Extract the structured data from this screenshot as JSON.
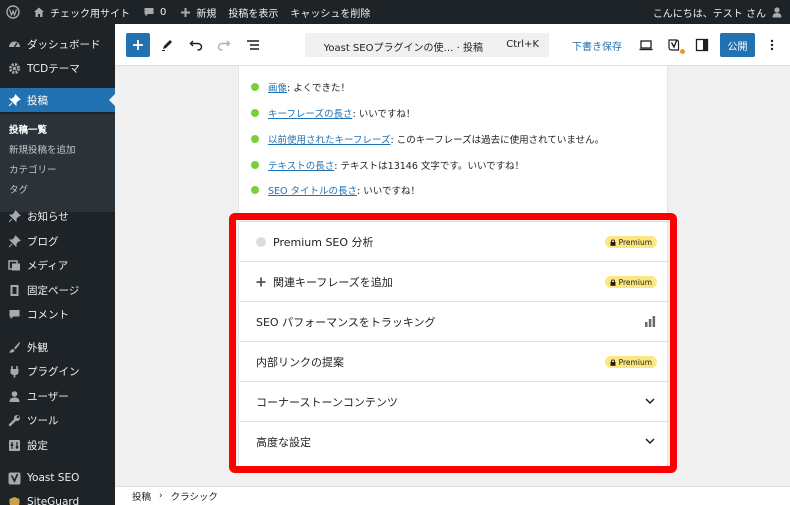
{
  "admin_bar": {
    "site_name": "チェック用サイト",
    "comments_count": "0",
    "new_label": "新規",
    "view_post": "投稿を表示",
    "purge_cache": "キャッシュを削除",
    "greeting": "こんにちは、テスト さん"
  },
  "sidebar": {
    "items": [
      {
        "label": "ダッシュボード",
        "icon": "dashboard-icon"
      },
      {
        "label": "TCDテーマ",
        "icon": "gear-icon"
      },
      {
        "label": "投稿",
        "icon": "pin-icon",
        "active": true
      },
      {
        "label": "お知らせ",
        "icon": "pin-icon"
      },
      {
        "label": "ブログ",
        "icon": "pin-icon"
      },
      {
        "label": "メディア",
        "icon": "media-icon"
      },
      {
        "label": "固定ページ",
        "icon": "page-icon"
      },
      {
        "label": "コメント",
        "icon": "comment-icon"
      },
      {
        "label": "外観",
        "icon": "brush-icon"
      },
      {
        "label": "プラグイン",
        "icon": "plugin-icon"
      },
      {
        "label": "ユーザー",
        "icon": "user-icon"
      },
      {
        "label": "ツール",
        "icon": "wrench-icon"
      },
      {
        "label": "設定",
        "icon": "settings-icon"
      },
      {
        "label": "Yoast SEO",
        "icon": "yoast-icon"
      },
      {
        "label": "SiteGuard",
        "icon": "shield-icon"
      }
    ],
    "submenu": [
      "投稿一覧",
      "新規投稿を追加",
      "カテゴリー",
      "タグ"
    ]
  },
  "toolbar": {
    "doc_title": "Yoast SEOプラグインの使…  · 投稿",
    "shortcut": "Ctrl+K",
    "save_draft": "下書き保存",
    "publish": "公開"
  },
  "checks": [
    {
      "link": "画像",
      "text": ": よくできた！"
    },
    {
      "link": "キーフレーズの長さ",
      "text": ": いいですね！"
    },
    {
      "link": "以前使用されたキーフレーズ",
      "text": ": このキーフレーズは過去に使用されていません。"
    },
    {
      "link": "テキストの長さ",
      "text": ": テキストは13146 文字です。いいですね！"
    },
    {
      "link": "SEO タイトルの長さ",
      "text": ": いいですね！"
    }
  ],
  "features": {
    "premium_analysis": "Premium SEO 分析",
    "related_keyphrase": "関連キーフレーズを追加",
    "tracking": "SEO パフォーマンスをトラッキング",
    "internal_links": "内部リンクの提案",
    "cornerstone": "コーナーストーンコンテンツ",
    "advanced": "高度な設定",
    "premium_badge": "Premium"
  },
  "breadcrumb": {
    "first": "投稿",
    "separator": "›",
    "second": "クラシック"
  },
  "colors": {
    "admin_dark": "#1d2327",
    "wp_blue": "#2271b1",
    "good_green": "#7ad03a",
    "premium_yellow": "#fce682",
    "highlight_red": "#ff0000"
  }
}
